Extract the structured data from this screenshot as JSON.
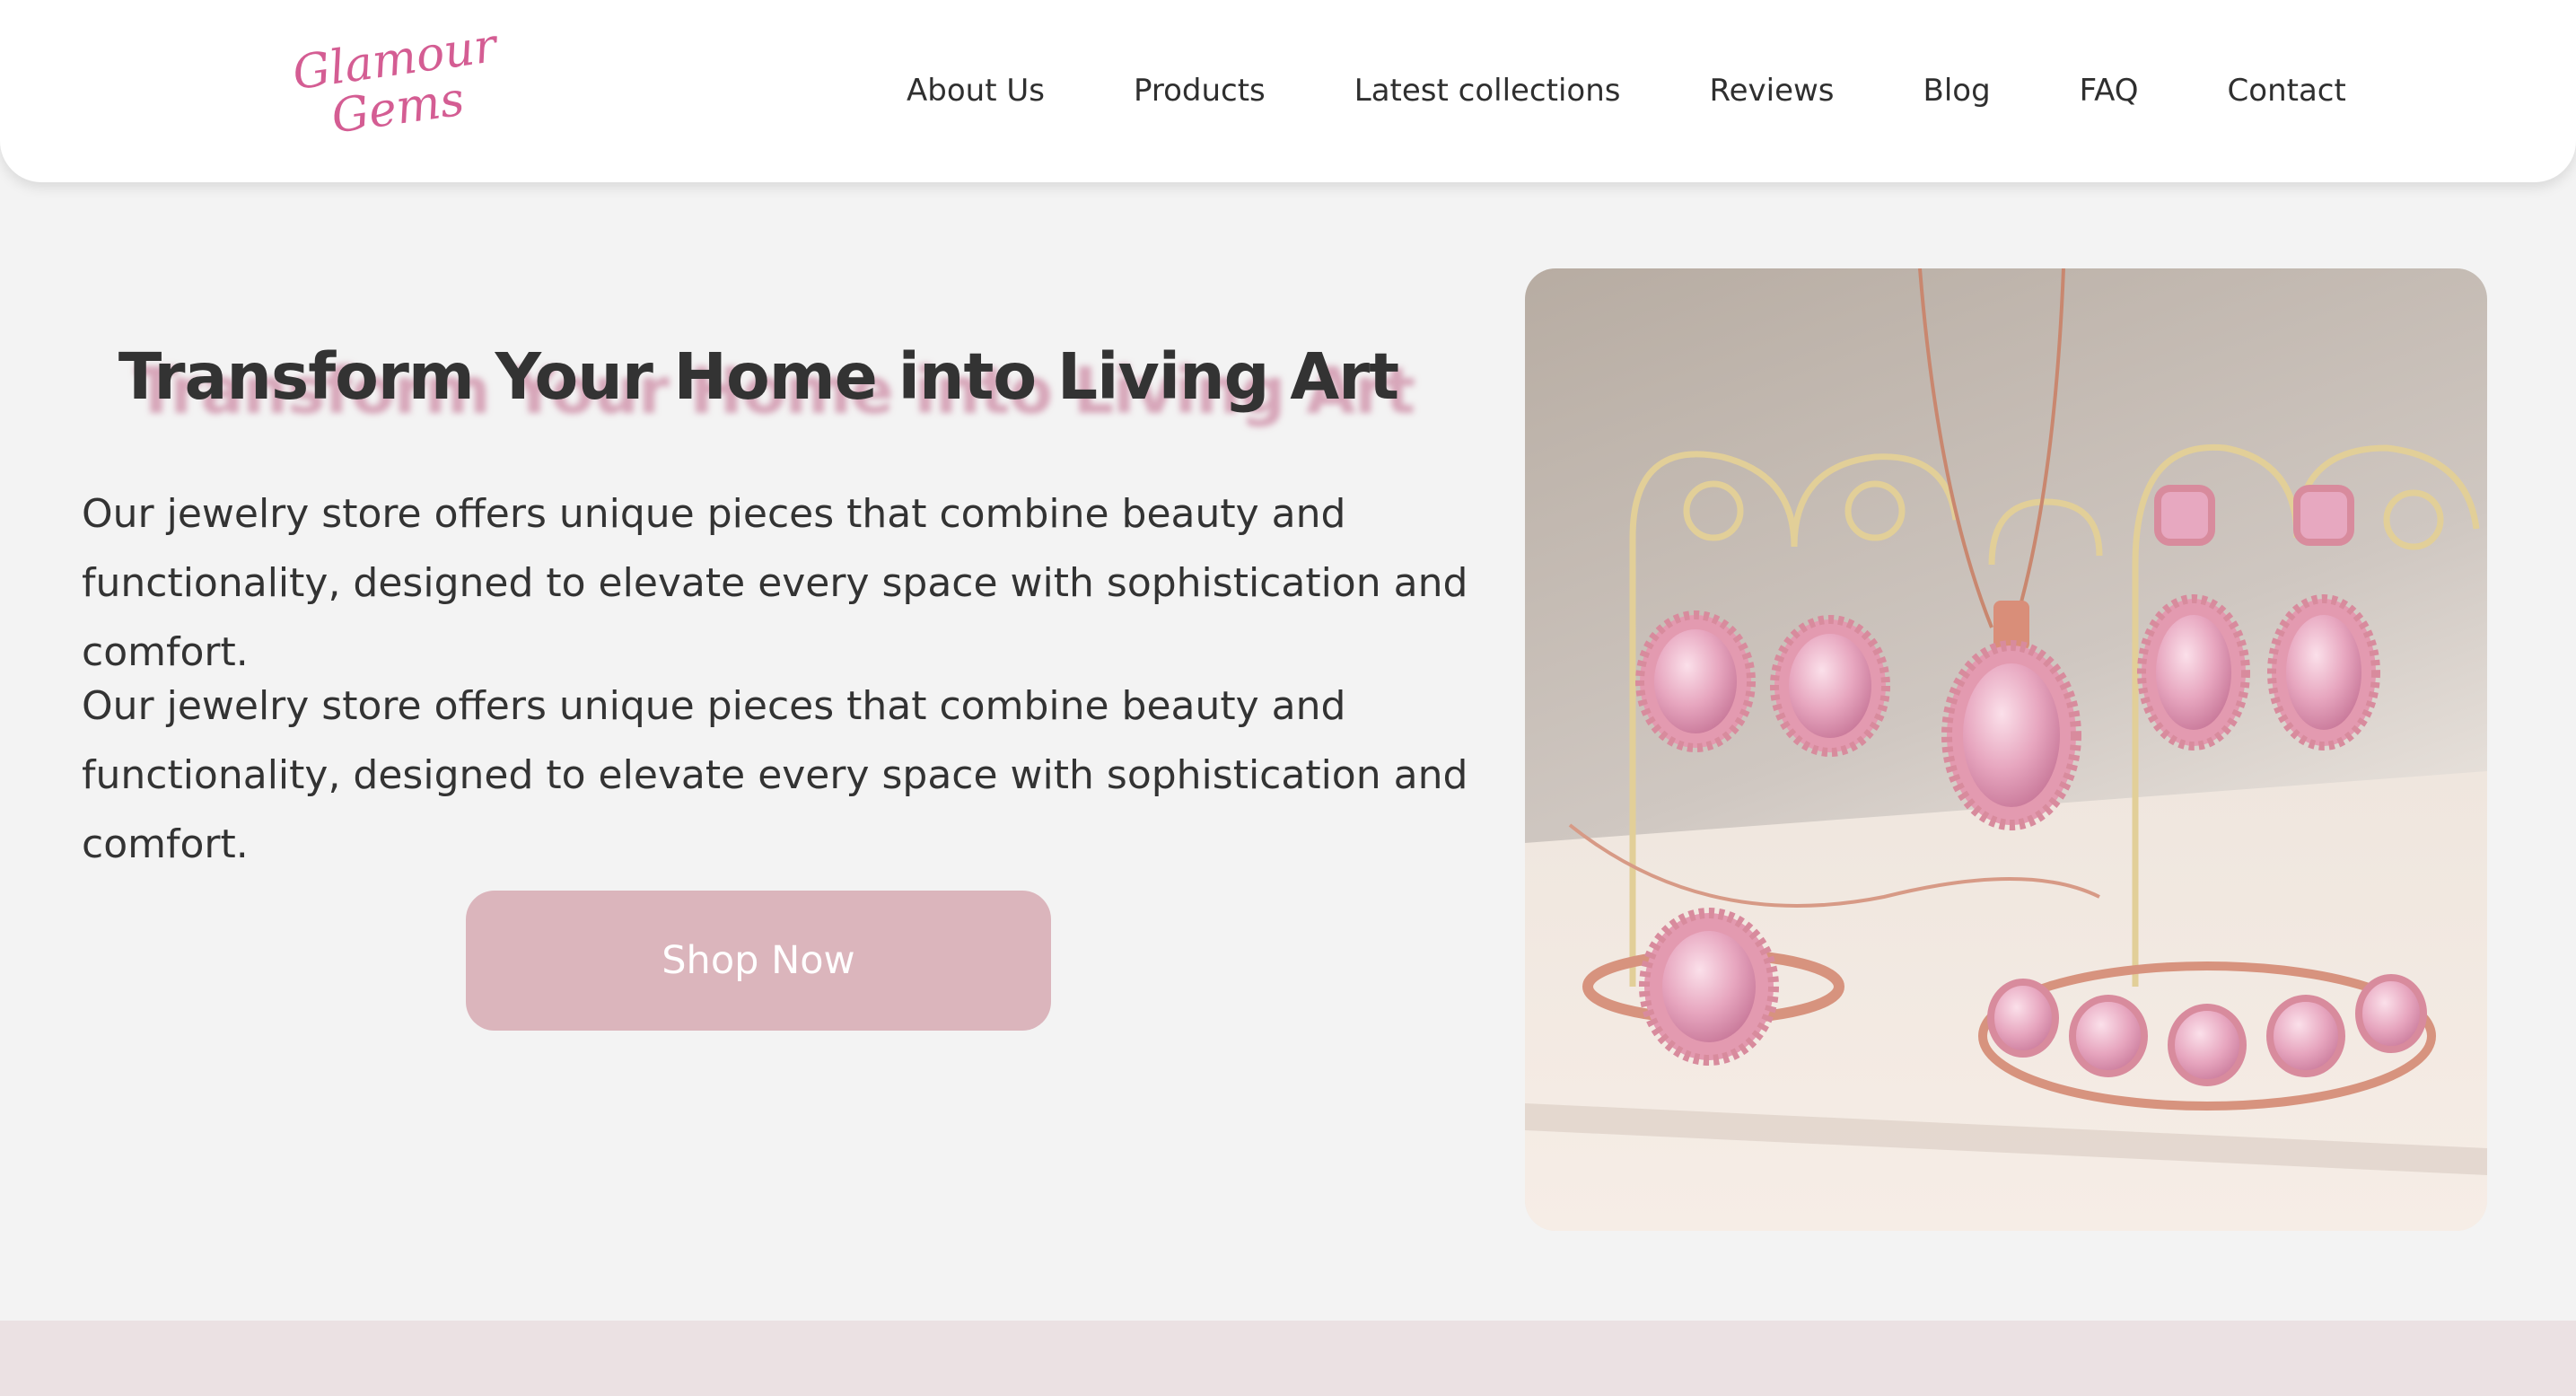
{
  "header": {
    "logo": {
      "line1": "Glamour",
      "line2": "Gems"
    },
    "nav": [
      {
        "label": "About Us"
      },
      {
        "label": "Products"
      },
      {
        "label": "Latest collections"
      },
      {
        "label": "Reviews"
      },
      {
        "label": "Blog"
      },
      {
        "label": "FAQ"
      },
      {
        "label": "Contact"
      }
    ]
  },
  "hero": {
    "title": "Transform Your Home into Living Art",
    "paragraphs": [
      "Our jewelry store offers unique pieces that combine beauty and functionality, designed to elevate every space with sophistication and comfort.",
      "Our jewelry store offers unique pieces that combine beauty and functionality, designed to elevate every space with sophistication and comfort."
    ],
    "cta_label": "Shop Now",
    "image_icon": "jewelry-set-photo"
  },
  "colors": {
    "page_background": "#f3f3f3",
    "header_background": "#ffffff",
    "logo_pink": "#d45d93",
    "text_dark": "#333333",
    "button_background": "#dbb5bc",
    "button_text": "#ffffff",
    "title_shadow": "#cd8ca5",
    "bottom_band": "#ebe1e3"
  }
}
